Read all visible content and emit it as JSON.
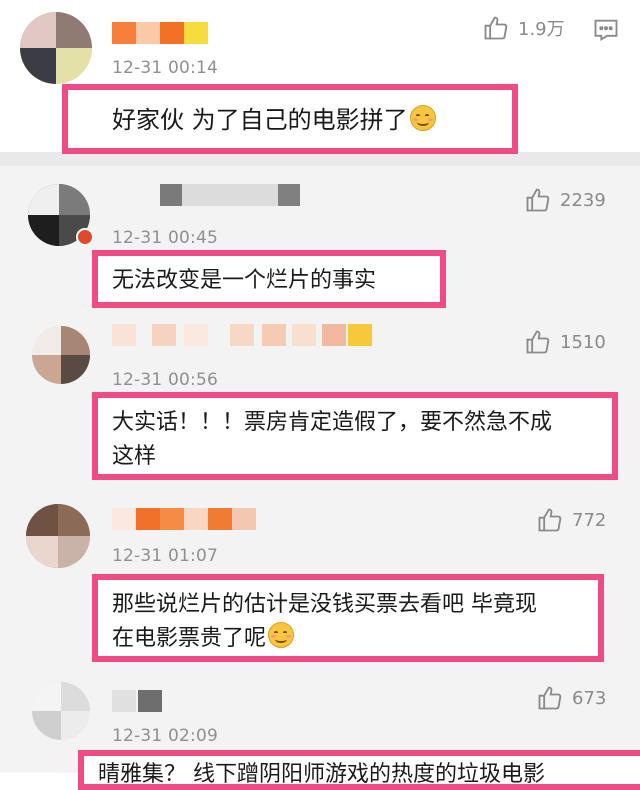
{
  "colors": {
    "accent_border": "#ef4c86",
    "meta_text": "#8f8f8f",
    "reply_bg": "#f3f3f3"
  },
  "comments": [
    {
      "id": "c1",
      "time": "12-31 00:14",
      "likes": "1.9万",
      "lines": [
        "好家伙 为了自己的电影拼了"
      ],
      "emoji": true,
      "icon": "thumb-up-icon"
    },
    {
      "id": "c2",
      "time": "12-31 00:45",
      "likes": "2239",
      "lines": [
        "无法改变是一个烂片的事实"
      ],
      "emoji": false,
      "icon": "thumb-up-icon"
    },
    {
      "id": "c3",
      "time": "12-31 00:56",
      "likes": "1510",
      "lines": [
        "大实话！！！票房肯定造假了，要不然急不成",
        "这样"
      ],
      "emoji": false,
      "icon": "thumb-up-icon"
    },
    {
      "id": "c4",
      "time": "12-31 01:07",
      "likes": "772",
      "lines": [
        "那些说烂片的估计是没钱买票去看吧 毕竟现",
        "在电影票贵了呢"
      ],
      "emoji": true,
      "icon": "thumb-up-icon"
    },
    {
      "id": "c5",
      "time": "12-31 02:09",
      "likes": "673",
      "lines": [
        "晴雅集？ 线下蹭阴阳师游戏的热度的垃圾电影"
      ],
      "emoji": false,
      "icon": "thumb-up-icon"
    }
  ],
  "icons": {
    "reply": "comment-bubble-icon"
  }
}
